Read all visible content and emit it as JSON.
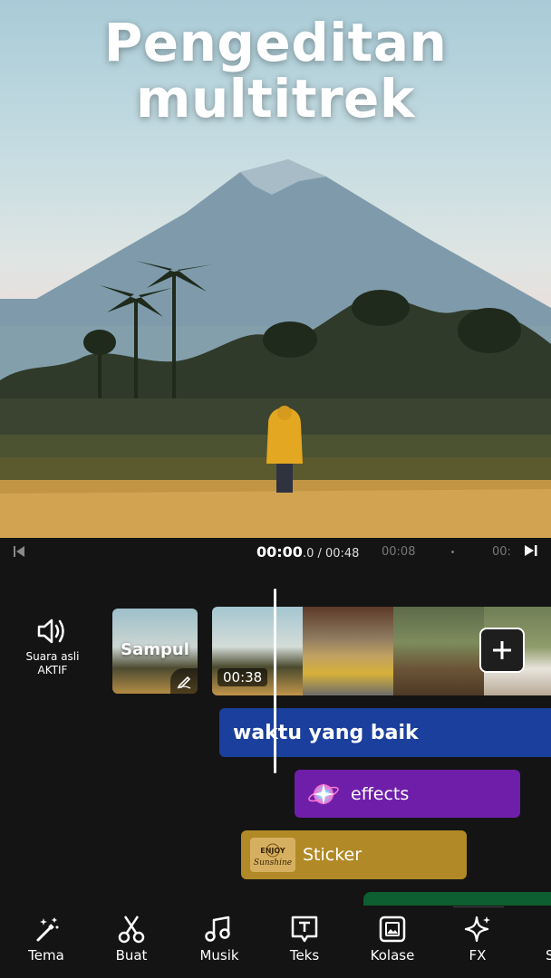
{
  "hero": {
    "title_line1": "Pengeditan",
    "title_line2": "multitrek"
  },
  "timeline_header": {
    "current_time": "00:00",
    "current_frac": ".0",
    "total": " / 00:48",
    "tick_1": "00:08",
    "tick_2": "00:"
  },
  "audio": {
    "icon": "speaker-icon",
    "label_line1": "Suara asli",
    "label_line2": "AKTIF"
  },
  "clips": {
    "cover_label": "Sampul",
    "duration": "00:38"
  },
  "tracks": {
    "text": "waktu yang baik",
    "effects": "effects",
    "sticker": "Sticker",
    "sticker_badge_line1": "ENJOY",
    "sticker_badge_line2": "Sunshine"
  },
  "toolbar": [
    {
      "label": "Tema",
      "icon": "magic-wand-icon"
    },
    {
      "label": "Buat",
      "icon": "scissors-icon"
    },
    {
      "label": "Musik",
      "icon": "music-note-icon"
    },
    {
      "label": "Teks",
      "icon": "text-icon"
    },
    {
      "label": "Kolase",
      "icon": "collage-icon"
    },
    {
      "label": "FX",
      "icon": "sparkle-icon"
    },
    {
      "label": "S",
      "icon": "partial-tool"
    }
  ],
  "colors": {
    "text_track": "#1a3f9c",
    "effects_track": "#6f1eaa",
    "sticker_track": "#b18a27",
    "green_track": "#0d5e30"
  }
}
